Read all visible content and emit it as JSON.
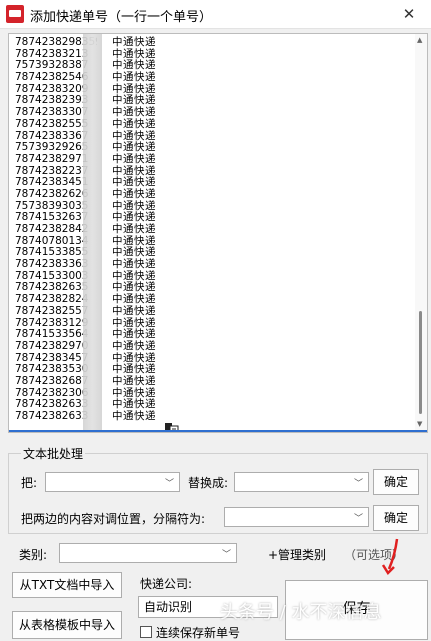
{
  "window": {
    "title": "添加快递单号（一行一个单号）",
    "close_glyph": "✕"
  },
  "list": {
    "rows": [
      {
        "number": "78742382983599",
        "company": "中通快递"
      },
      {
        "number": "78742383213",
        "company": "中通快递"
      },
      {
        "number": "75739328387",
        "company": "中通快递"
      },
      {
        "number": "78742382546",
        "company": "中通快递"
      },
      {
        "number": "78742383209",
        "company": "中通快递"
      },
      {
        "number": "78742382393",
        "company": "中通快递"
      },
      {
        "number": "78742383307",
        "company": "中通快递"
      },
      {
        "number": "78742382555",
        "company": "中通快递"
      },
      {
        "number": "78742383367",
        "company": "中通快递"
      },
      {
        "number": "75739329265",
        "company": "中通快递"
      },
      {
        "number": "78742382971",
        "company": "中通快递"
      },
      {
        "number": "78742382237",
        "company": "中通快递"
      },
      {
        "number": "78742383451",
        "company": "中通快递"
      },
      {
        "number": "78742382626",
        "company": "中通快递"
      },
      {
        "number": "75738393035",
        "company": "中通快递"
      },
      {
        "number": "78741532637",
        "company": "中通快递"
      },
      {
        "number": "78742382842",
        "company": "中通快递"
      },
      {
        "number": "78740780134",
        "company": "中通快递"
      },
      {
        "number": "78741533855",
        "company": "中通快递"
      },
      {
        "number": "78742383363",
        "company": "中通快递"
      },
      {
        "number": "78741533003",
        "company": "中通快递"
      },
      {
        "number": "78742382635",
        "company": "中通快递"
      },
      {
        "number": "78742382824",
        "company": "中通快递"
      },
      {
        "number": "78742382557",
        "company": "中通快递"
      },
      {
        "number": "78742383129",
        "company": "中通快递"
      },
      {
        "number": "78741533564",
        "company": "中通快递"
      },
      {
        "number": "78742382970",
        "company": "中通快递"
      },
      {
        "number": "78742383457",
        "company": "中通快递"
      },
      {
        "number": "78742383530",
        "company": "中通快递"
      },
      {
        "number": "78742382687",
        "company": "中通快递"
      },
      {
        "number": "78742382306",
        "company": "中通快递"
      },
      {
        "number": "78742382633",
        "company": "中通快递"
      },
      {
        "number": "78742382633",
        "company": "中通快递"
      }
    ]
  },
  "batch": {
    "group_title": "文本批处理",
    "replace_label": "把:",
    "replace_with_label": "替换成:",
    "confirm_label": "确定",
    "swap_label": "把两边的内容对调位置，分隔符为:",
    "confirm2_label": "确定"
  },
  "category": {
    "label": "类别:",
    "manage_label": "+管理类别",
    "optional_label": "（可选项）"
  },
  "import": {
    "txt_button": "从TXT文档中导入",
    "table_button": "从表格模板中导入"
  },
  "courier": {
    "label": "快递公司:",
    "value": "自动识别",
    "keep_saving_label": "连续保存新单号"
  },
  "save": {
    "label": "保存"
  },
  "watermark": "头条号 / 水不深信息",
  "icons": {
    "app": "app-logo-icon",
    "dropdown": "chevron-down-icon",
    "cursor": "paste-cursor-icon"
  },
  "colors": {
    "accent": "#2f6fd0",
    "arrow": "#e02020"
  }
}
